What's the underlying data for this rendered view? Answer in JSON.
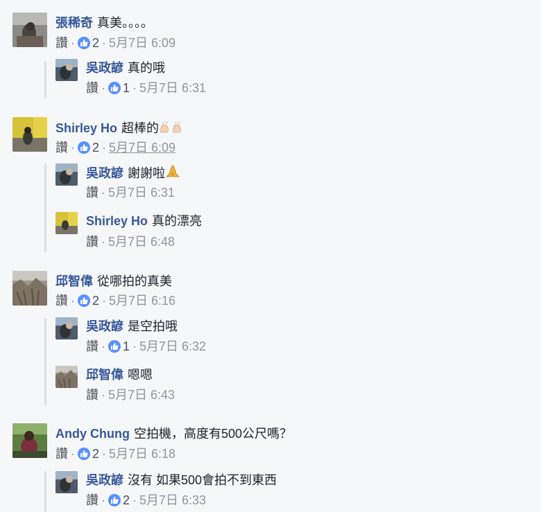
{
  "like_label": "讚",
  "threads": [
    {
      "comment": {
        "author": "張稀奇",
        "text": "真美。。。。",
        "likes": "2",
        "time": "5月7日 6:09"
      },
      "replies": [
        {
          "author": "吳政諺",
          "text": "真的哦",
          "likes": "1",
          "time": "5月7日 6:31"
        }
      ]
    },
    {
      "comment": {
        "author": "Shirley Ho",
        "text": "超棒的",
        "likes": "2",
        "time": "5月7日 6:09"
      },
      "replies": [
        {
          "author": "吳政諺",
          "text": "謝謝啦",
          "time": "5月7日 6:31"
        },
        {
          "author": "Shirley Ho",
          "text": "真的漂亮",
          "time": "5月7日 6:48"
        }
      ]
    },
    {
      "comment": {
        "author": "邱智偉",
        "text": "從哪拍的真美",
        "likes": "2",
        "time": "5月7日 6:16"
      },
      "replies": [
        {
          "author": "吳政諺",
          "text": "是空拍哦",
          "likes": "1",
          "time": "5月7日 6:32"
        },
        {
          "author": "邱智偉",
          "text": "嗯嗯",
          "time": "5月7日 6:43"
        }
      ]
    },
    {
      "comment": {
        "author": "Andy Chung",
        "text": "空拍機，高度有500公尺嗎？",
        "likes": "2",
        "time": "5月7日 6:18"
      },
      "replies": [
        {
          "author": "吳政諺",
          "text": "沒有 如果500會拍不到東西",
          "likes": "2",
          "time": "5月7日 6:33"
        }
      ]
    }
  ]
}
